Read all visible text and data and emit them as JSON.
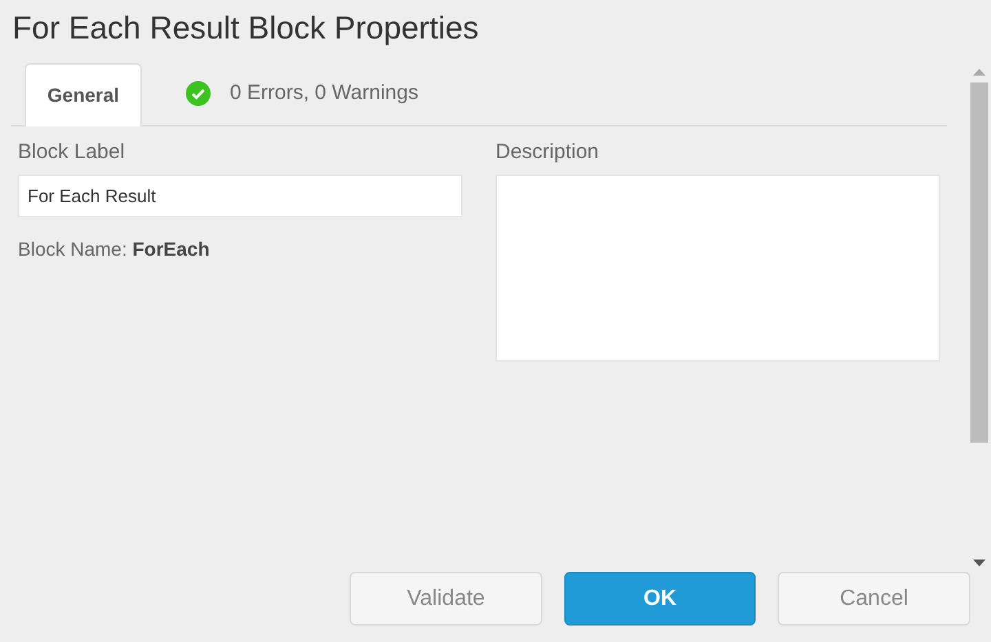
{
  "window": {
    "title": "For Each Result Block Properties"
  },
  "tabs": [
    {
      "label": "General",
      "selected": true
    }
  ],
  "validation": {
    "ok": true,
    "text": "0 Errors, 0 Warnings"
  },
  "block_label": {
    "label": "Block Label",
    "value": "For Each Result"
  },
  "block_name": {
    "label": "Block Name:",
    "value": "ForEach"
  },
  "description": {
    "label": "Description"
  },
  "buttons": [
    {
      "label": "Validate",
      "kind": "secondary"
    },
    {
      "label": "OK",
      "kind": "primary"
    },
    {
      "label": "Cancel",
      "kind": "secondary"
    }
  ]
}
